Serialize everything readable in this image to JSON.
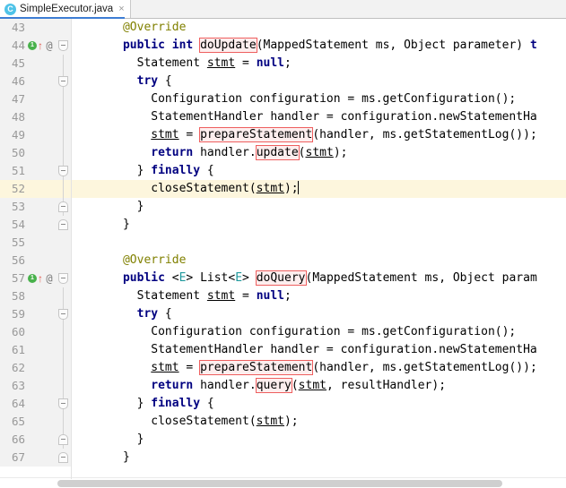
{
  "window": {
    "title": "SimpleExecutor.java"
  },
  "tab": {
    "icon": "java-class-icon",
    "label": "SimpleExecutor.java",
    "close_label": "×"
  },
  "gutter": {
    "run_marker_label": "1",
    "override_arrow_glyph": "↑",
    "annotation_glyph": "@"
  },
  "editor": {
    "caret_line": 52,
    "first_visible_line": 43,
    "last_visible_line": 67,
    "colors": {
      "keyword": "#000080",
      "annotation": "#808000",
      "generic_type": "#20999d",
      "highlight_box_border": "#ee5f5f",
      "highlight_box_fill": "#fdeeee",
      "current_line_background": "#fdf6dd",
      "gutter_background": "#f2f2f2",
      "line_number": "#999999",
      "tab_underline": "#3d7dd4"
    },
    "lines": [
      {
        "n": "43",
        "indent": 6,
        "text": "@Override"
      },
      {
        "n": "44",
        "indent": 6,
        "text": "public int doUpdate(MappedStatement ms, Object parameter) t"
      },
      {
        "n": "45",
        "indent": 8,
        "text": "Statement stmt = null;"
      },
      {
        "n": "46",
        "indent": 8,
        "text": "try {"
      },
      {
        "n": "47",
        "indent": 10,
        "text": "Configuration configuration = ms.getConfiguration();"
      },
      {
        "n": "48",
        "indent": 10,
        "text": "StatementHandler handler = configuration.newStatementHa"
      },
      {
        "n": "49",
        "indent": 10,
        "text": "stmt = prepareStatement(handler, ms.getStatementLog());"
      },
      {
        "n": "50",
        "indent": 10,
        "text": "return handler.update(stmt);"
      },
      {
        "n": "51",
        "indent": 8,
        "text": "} finally {"
      },
      {
        "n": "52",
        "indent": 10,
        "text": "closeStatement(stmt);"
      },
      {
        "n": "53",
        "indent": 8,
        "text": "}"
      },
      {
        "n": "54",
        "indent": 6,
        "text": "}"
      },
      {
        "n": "55",
        "indent": 0,
        "text": ""
      },
      {
        "n": "56",
        "indent": 6,
        "text": "@Override"
      },
      {
        "n": "57",
        "indent": 6,
        "text": "public <E> List<E> doQuery(MappedStatement ms, Object param"
      },
      {
        "n": "58",
        "indent": 8,
        "text": "Statement stmt = null;"
      },
      {
        "n": "59",
        "indent": 8,
        "text": "try {"
      },
      {
        "n": "60",
        "indent": 10,
        "text": "Configuration configuration = ms.getConfiguration();"
      },
      {
        "n": "61",
        "indent": 10,
        "text": "StatementHandler handler = configuration.newStatementHa"
      },
      {
        "n": "62",
        "indent": 10,
        "text": "stmt = prepareStatement(handler, ms.getStatementLog());"
      },
      {
        "n": "63",
        "indent": 10,
        "text": "return handler.query(stmt, resultHandler);"
      },
      {
        "n": "64",
        "indent": 8,
        "text": "} finally {"
      },
      {
        "n": "65",
        "indent": 10,
        "text": "closeStatement(stmt);"
      },
      {
        "n": "66",
        "indent": 8,
        "text": "}"
      },
      {
        "n": "67",
        "indent": 6,
        "text": "}"
      }
    ],
    "highlighted_occurrences": [
      "doUpdate",
      "prepareStatement",
      "update",
      "doQuery",
      "query"
    ]
  },
  "scrollbar": {
    "orientation": "horizontal",
    "name": "horizontal-scrollbar"
  }
}
